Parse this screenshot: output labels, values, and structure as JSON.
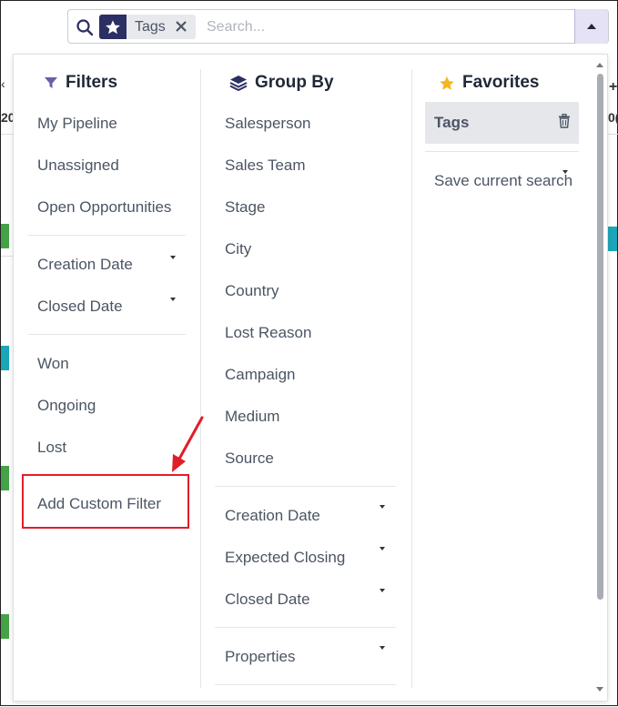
{
  "search": {
    "facet_label": "Tags",
    "placeholder": "Search..."
  },
  "filters": {
    "heading": "Filters",
    "items": [
      "My Pipeline",
      "Unassigned",
      "Open Opportunities"
    ],
    "date_items": [
      "Creation Date",
      "Closed Date"
    ],
    "status_items": [
      "Won",
      "Ongoing",
      "Lost"
    ],
    "custom": "Add Custom Filter"
  },
  "group_by": {
    "heading": "Group By",
    "items": [
      "Salesperson",
      "Sales Team",
      "Stage",
      "City",
      "Country",
      "Lost Reason",
      "Campaign",
      "Medium",
      "Source"
    ],
    "date_items": [
      "Creation Date",
      "Expected Closing",
      "Closed Date"
    ],
    "properties": "Properties"
  },
  "favorites": {
    "heading": "Favorites",
    "active_item": "Tags",
    "save_search": "Save current search"
  },
  "colors": {
    "accent_dark": "#2b2f63",
    "funnel": "#6b5ea8",
    "star": "#f3b61f",
    "annotation_red": "#e11d2a"
  }
}
